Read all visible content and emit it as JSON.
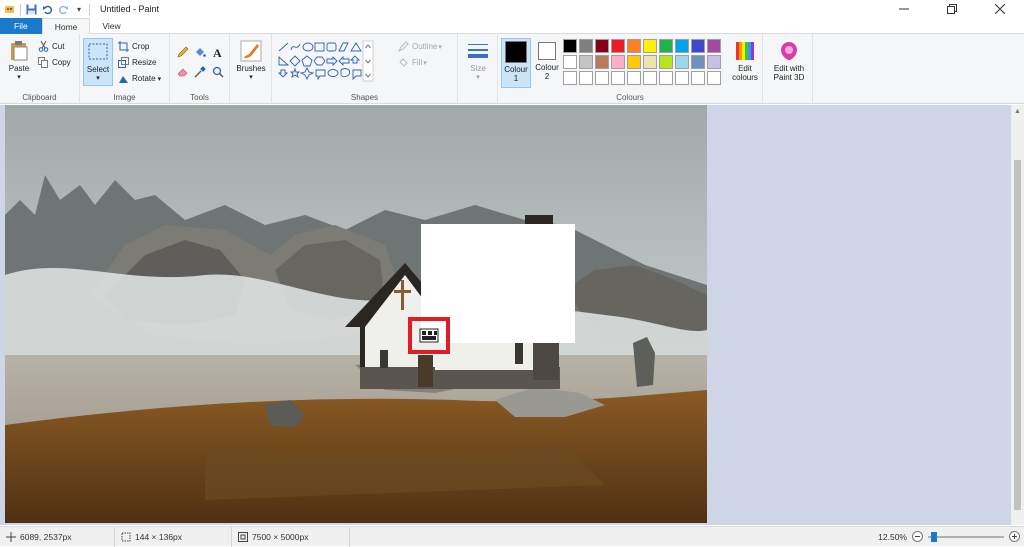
{
  "window": {
    "title": "Untitled - Paint",
    "controls": [
      "minimize",
      "restore",
      "close"
    ]
  },
  "tabs": [
    {
      "label": "File"
    },
    {
      "label": "Home"
    },
    {
      "label": "View"
    }
  ],
  "ribbon": {
    "clipboard": {
      "paste": "Paste",
      "cut": "Cut",
      "copy": "Copy",
      "group": "Clipboard"
    },
    "image": {
      "select": "Select",
      "crop": "Crop",
      "resize": "Resize",
      "rotate": "Rotate",
      "group": "Image"
    },
    "tools": {
      "group": "Tools"
    },
    "brushes": {
      "label": "Brushes"
    },
    "shapes": {
      "outline": "Outline",
      "fill": "Fill",
      "group": "Shapes"
    },
    "size": {
      "label": "Size"
    },
    "colours": {
      "colour1_line1": "Colour",
      "colour1_line2": "1",
      "colour2_line1": "Colour",
      "colour2_line2": "2",
      "edit_line1": "Edit",
      "edit_line2": "colours",
      "group": "Colours",
      "colour1_value": "#000000",
      "colour2_value": "#ffffff",
      "palette_row1": [
        "#000000",
        "#7f7f7f",
        "#880015",
        "#ed1c24",
        "#ff7f27",
        "#fff200",
        "#22b14c",
        "#00a2e8",
        "#3f48cc",
        "#a349a4"
      ],
      "palette_row2": [
        "#ffffff",
        "#c3c3c3",
        "#b97a57",
        "#ffaec9",
        "#ffc90e",
        "#efe4b0",
        "#b5e61d",
        "#99d9ea",
        "#7092be",
        "#c8bfe7"
      ],
      "palette_row3": [
        "#ffffff",
        "#ffffff",
        "#ffffff",
        "#ffffff",
        "#ffffff",
        "#ffffff",
        "#ffffff",
        "#ffffff",
        "#ffffff",
        "#ffffff"
      ]
    },
    "paint3d": {
      "line1": "Edit with",
      "line2": "Paint 3D"
    }
  },
  "status": {
    "cursor_pos": "6089, 2537px",
    "selection_size": "144 × 136px",
    "image_size": "7500 × 5000px",
    "zoom": "12.50%"
  }
}
